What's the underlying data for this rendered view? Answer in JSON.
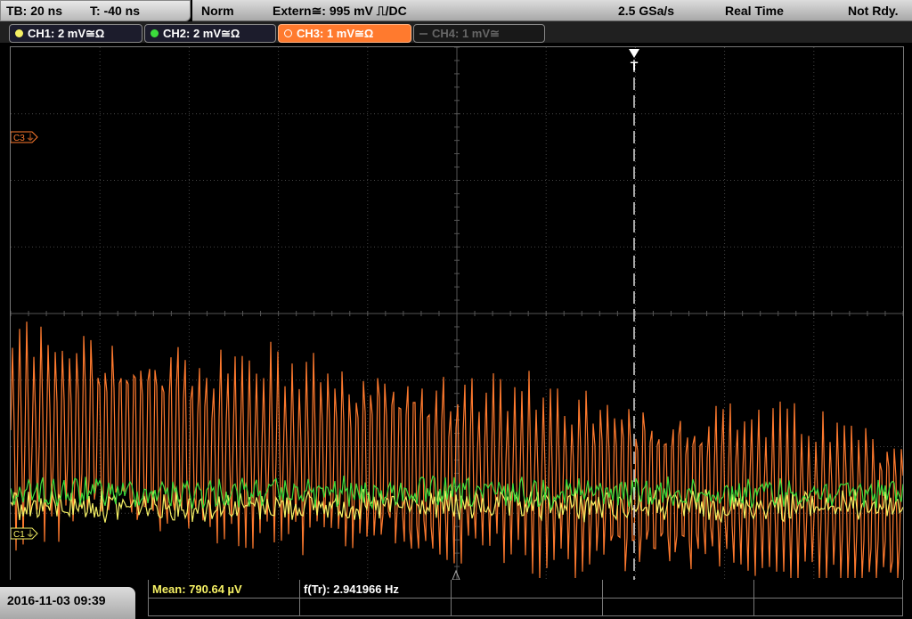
{
  "topbar": {
    "timebase": "TB: 20 ns",
    "trigger_time": "T: -40 ns",
    "mode": "Norm",
    "trigger_source": "Extern≅: 995 mV ⎍/DC",
    "sample_rate": "2.5 GSa/s",
    "acq_mode": "Real Time",
    "status": "Not Rdy."
  },
  "channels": [
    {
      "label": "CH1: 2 mV≅Ω",
      "color": "#f5f064",
      "active": true
    },
    {
      "label": "CH2: 2 mV≅Ω",
      "color": "#3cdc3c",
      "active": true
    },
    {
      "label": "CH3: 1 mV≅Ω",
      "color": "#ff7a2e",
      "active": true,
      "selected": true
    },
    {
      "label": "CH4: 1 mV≅",
      "color": "#666666",
      "active": false
    }
  ],
  "markers": {
    "c3": "C3",
    "c1": "C1"
  },
  "trigger_marker": "T",
  "bottom": {
    "datetime": "2016-11-03 09:39",
    "mean": "Mean: 790.64 µV",
    "freq": "f(Tr): 2.941966 Hz"
  },
  "colors": {
    "ch1": "#f5f064",
    "ch2": "#3cdc3c",
    "ch3": "#ff7a2e",
    "grid": "#444444"
  }
}
